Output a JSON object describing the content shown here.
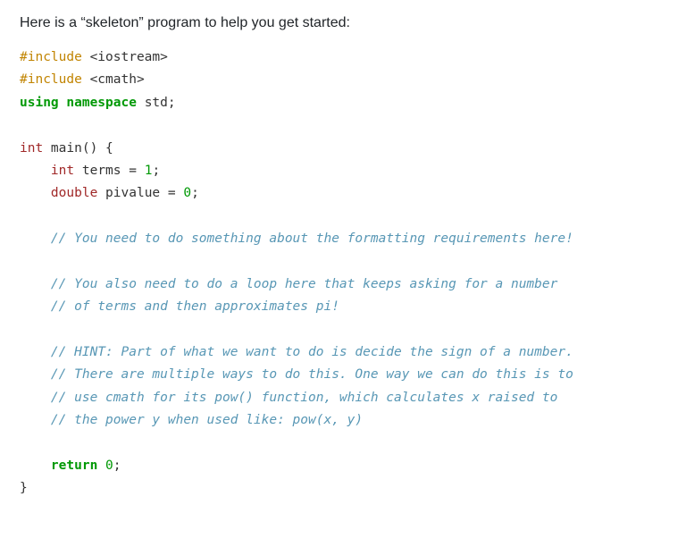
{
  "intro": "Here is a “skeleton” program to help you get started:",
  "code": {
    "l01a": "#include",
    "l01b": " <iostream>",
    "l02a": "#include",
    "l02b": " <cmath>",
    "l03a": "using",
    "l03b": " ",
    "l03c": "namespace",
    "l03d": " std;",
    "l04": "",
    "l05a": "int",
    "l05b": " main() {",
    "l06a": "    ",
    "l06b": "int",
    "l06c": " terms = ",
    "l06d": "1",
    "l06e": ";",
    "l07a": "    ",
    "l07b": "double",
    "l07c": " pivalue = ",
    "l07d": "0",
    "l07e": ";",
    "l08": "",
    "l09a": "    ",
    "l09b": "// You need to do something about the formatting requirements here!",
    "l10": "",
    "l11a": "    ",
    "l11b": "// You also need to do a loop here that keeps asking for a number",
    "l12a": "    ",
    "l12b": "// of terms and then approximates pi!",
    "l13": "",
    "l14a": "    ",
    "l14b": "// HINT: Part of what we want to do is decide the sign of a number.",
    "l15a": "    ",
    "l15b": "// There are multiple ways to do this. One way we can do this is to",
    "l16a": "    ",
    "l16b": "// use cmath for its pow() function, which calculates x raised to",
    "l17a": "    ",
    "l17b": "// the power y when used like: pow(x, y)",
    "l18": "",
    "l19a": "    ",
    "l19b": "return",
    "l19c": " ",
    "l19d": "0",
    "l19e": ";",
    "l20": "}"
  }
}
